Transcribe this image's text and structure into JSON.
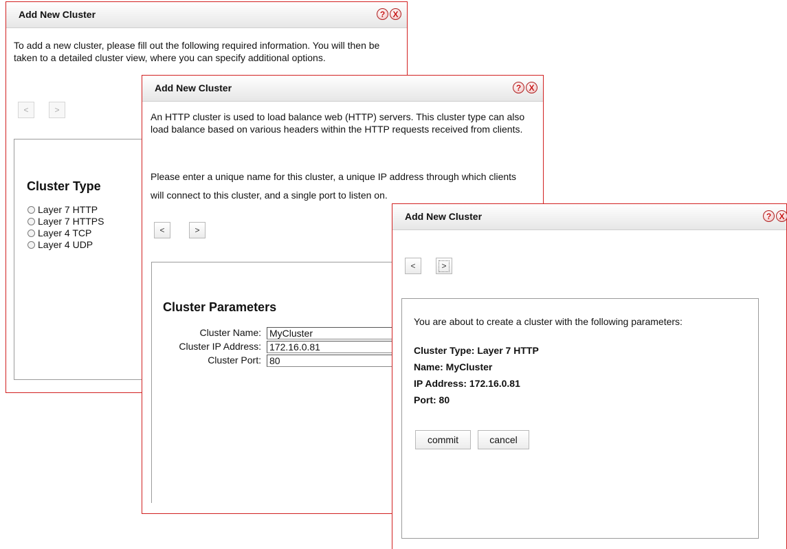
{
  "dialogs": {
    "d1": {
      "title": "Add New Cluster",
      "intro": "To add a new cluster, please fill out the following required information. You will then be taken to a detailed cluster view, where you can specify additional options.",
      "back_label": "<",
      "next_label": ">",
      "section_title": "Cluster Type",
      "options": [
        "Layer 7 HTTP",
        "Layer 7 HTTPS",
        "Layer 4 TCP",
        "Layer 4 UDP"
      ]
    },
    "d2": {
      "title": "Add New Cluster",
      "intro": "An HTTP cluster is used to load balance web (HTTP) servers. This cluster type can also load balance based on various headers within the HTTP requests received from clients.",
      "instruction": "Please enter a unique name for this cluster, a unique IP address through which clients will connect to this cluster, and a single port to listen on.",
      "back_label": "<",
      "next_label": ">",
      "section_title": "Cluster Parameters",
      "fields": {
        "name_label": "Cluster Name:",
        "name_value": "MyCluster",
        "ip_label": "Cluster IP Address:",
        "ip_value": "172.16.0.81",
        "port_label": "Cluster Port:",
        "port_value": "80"
      }
    },
    "d3": {
      "title": "Add New Cluster",
      "back_label": "<",
      "next_label": ">",
      "summary_intro": "You are about to create a cluster with the following parameters:",
      "summary": {
        "type": "Cluster Type: Layer 7 HTTP",
        "name": "Name: MyCluster",
        "ip": "IP Address: 172.16.0.81",
        "port": "Port: 80"
      },
      "commit_label": "commit",
      "cancel_label": "cancel"
    }
  },
  "icons": {
    "help": "?",
    "close": "X"
  },
  "colors": {
    "dialog_border": "#d11f1f",
    "icon_red": "#c81818"
  }
}
